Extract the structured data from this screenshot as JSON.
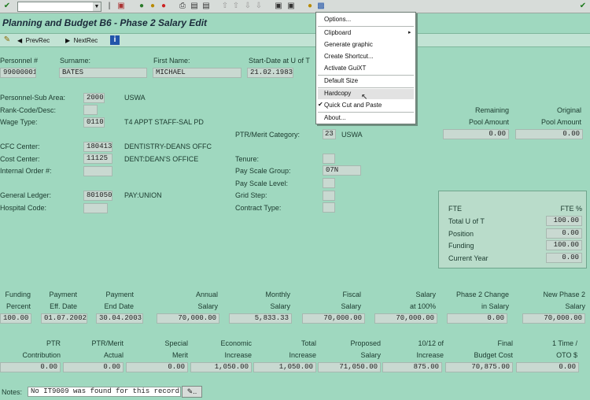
{
  "toolbar": {
    "command_value": ""
  },
  "title": "Planning and Budget B6 - Phase 2 Salary Edit",
  "appbar": {
    "prev_label": "PrevRec",
    "next_label": "NextRec"
  },
  "header": {
    "personnel_label": "Personnel #",
    "personnel_value": "99000001",
    "surname_label": "Surname:",
    "surname_value": "BATES",
    "firstname_label": "First Name:",
    "firstname_value": "MICHAEL",
    "startdate_label": "Start-Date at U of T",
    "startdate_value": "21.02.1983"
  },
  "details": {
    "subarea_label": "Personnel-Sub Area:",
    "subarea_value": "2000",
    "subarea_text": "USWA",
    "rank_label": "Rank-Code/Desc:",
    "rank_value": "",
    "wage_label": "Wage Type:",
    "wage_value": "0110",
    "wage_text": "T4 APPT STAFF-SAL PD",
    "cfc_label": "CFC Center:",
    "cfc_value": "180413",
    "cfc_text": "DENTISTRY-DEANS OFFC",
    "cost_label": "Cost Center:",
    "cost_value": "11125",
    "cost_text": "DENT:DEAN'S OFFICE",
    "order_label": "Internal Order #:",
    "order_value": "",
    "gl_label": "General Ledger:",
    "gl_value": "801050",
    "gl_text": "PAY:UNION",
    "hosp_label": "Hospital Code:",
    "hosp_value": ""
  },
  "ptr": {
    "category_label": "PTR/Merit Category:",
    "category_value": "23",
    "category_text": "USWA",
    "tenure_label": "Tenure:",
    "tenure_value": "",
    "group_label": "Pay Scale Group:",
    "group_value": "07N",
    "level_label": "Pay Scale Level:",
    "level_value": "",
    "step_label": "Grid Step:",
    "step_value": "",
    "contract_label": "Contract Type:",
    "contract_value": ""
  },
  "pool": {
    "remaining_label1": "Remaining",
    "remaining_label2": "Pool Amount",
    "remaining_value": "0.00",
    "original_label1": "Original",
    "original_label2": "Pool Amount",
    "original_value": "0.00"
  },
  "fte": {
    "title": "FTE",
    "pct_label": "FTE %",
    "rows": [
      {
        "label": "Total U of T",
        "value": "100.00"
      },
      {
        "label": "Position",
        "value": "0.00"
      },
      {
        "label": "Funding",
        "value": "100.00"
      },
      {
        "label": "Current Year",
        "value": "0.00"
      }
    ]
  },
  "funding": {
    "h1": [
      "Funding",
      "Payment",
      "Payment",
      "Annual",
      "Monthly",
      "Fiscal",
      "Salary",
      "Phase 2 Change",
      "New Phase 2"
    ],
    "h2": [
      "Percent",
      "Eff. Date",
      "End Date",
      "Salary",
      "Salary",
      "Salary",
      "at 100%",
      "in Salary",
      "Salary"
    ],
    "values": [
      "100.00",
      "01.07.2002",
      "30.04.2003",
      "70,000.00",
      "5,833.33",
      "70,000.00",
      "70,000.00",
      "0.00",
      "70,000.00"
    ]
  },
  "increase": {
    "h1": [
      "PTR",
      "PTR/Merit",
      "Special",
      "Economic",
      "Total",
      "Proposed",
      "10/12 of",
      "Final",
      "1 Time /"
    ],
    "h2": [
      "Contribution",
      "Actual",
      "Merit",
      "Increase",
      "Increase",
      "Salary",
      "Increase",
      "Budget Cost",
      "OTO $"
    ],
    "values": [
      "0.00",
      "0.00",
      "0.00",
      "1,050.00",
      "1,050.00",
      "71,050.00",
      "875.00",
      "70,875.00",
      "0.00"
    ]
  },
  "notes": {
    "label": "Notes:",
    "value": "No IT9009 was found for this record"
  },
  "menu": {
    "items": [
      "Options...",
      "Clipboard",
      "Generate graphic",
      "Create Shortcut...",
      "Activate GuiXT",
      "Default Size",
      "Hardcopy",
      "Quick Cut and Paste",
      "About..."
    ]
  }
}
